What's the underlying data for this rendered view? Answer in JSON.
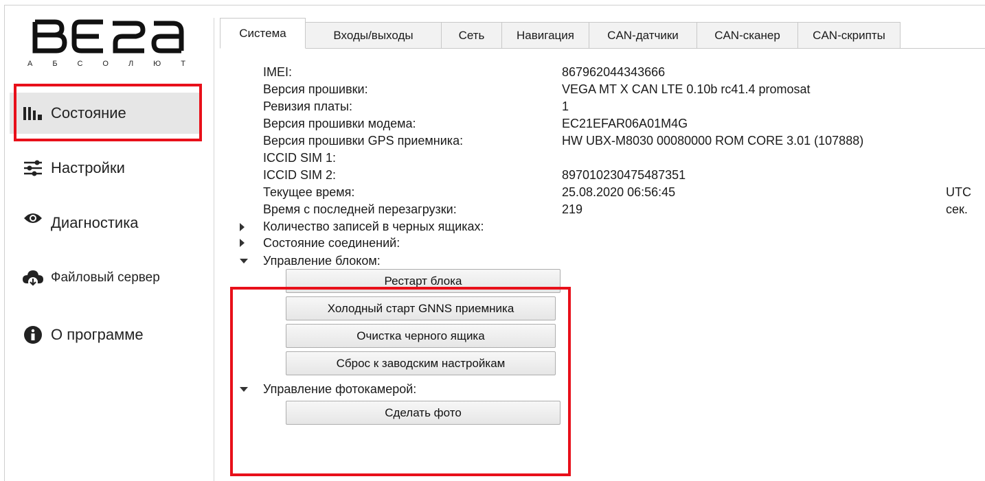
{
  "logo": {
    "text": "ВЕГА",
    "subtitle_letters": [
      "А",
      "Б",
      "С",
      "О",
      "Л",
      "Ю",
      "Т"
    ]
  },
  "sidebar": {
    "items": [
      {
        "label": "Состояние",
        "icon": "bar-chart-icon"
      },
      {
        "label": "Настройки",
        "icon": "sliders-icon"
      },
      {
        "label": "Диагностика",
        "icon": "eye-icon"
      },
      {
        "label": "Файловый сервер",
        "icon": "cloud-download-icon"
      },
      {
        "label": "О программе",
        "icon": "info-icon"
      }
    ]
  },
  "tabs": [
    "Система",
    "Входы/выходы",
    "Сеть",
    "Навигация",
    "CAN-датчики",
    "CAN-сканер",
    "CAN-скрипты"
  ],
  "info": [
    {
      "label": "IMEI:",
      "value": "867962044343666",
      "unit": ""
    },
    {
      "label": "Версия прошивки:",
      "value": "VEGA MT X CAN LTE 0.10b rc41.4 promosat",
      "unit": ""
    },
    {
      "label": "Ревизия платы:",
      "value": "1",
      "unit": ""
    },
    {
      "label": "Версия прошивки модема:",
      "value": "EC21EFAR06A01M4G",
      "unit": ""
    },
    {
      "label": "Версия прошивки GPS приемника:",
      "value": "HW UBX-M8030 00080000 ROM CORE 3.01 (107888)",
      "unit": ""
    },
    {
      "label": "ICCID SIM 1:",
      "value": "",
      "unit": ""
    },
    {
      "label": "ICCID SIM 2:",
      "value": "897010230475487351",
      "unit": ""
    },
    {
      "label": "Текущее время:",
      "value": "25.08.2020 06:56:45",
      "unit": "UTC"
    },
    {
      "label": "Время с последней перезагрузки:",
      "value": "219",
      "unit": "сек."
    }
  ],
  "tree": {
    "blackbox": "Количество записей в черных ящиках:",
    "connections": "Состояние соединений:",
    "unit_control": "Управление блоком:",
    "camera_control": "Управление фотокамерой:"
  },
  "buttons": {
    "restart": "Рестарт блока",
    "gnss_cold": "Холодный старт GNNS приемника",
    "clear_blackbox": "Очистка черного ящика",
    "factory_reset": "Сброс к заводским настройкам",
    "take_photo": "Сделать фото"
  },
  "colors": {
    "highlight": "#e8101a",
    "active_nav": "#e6e6e6"
  }
}
